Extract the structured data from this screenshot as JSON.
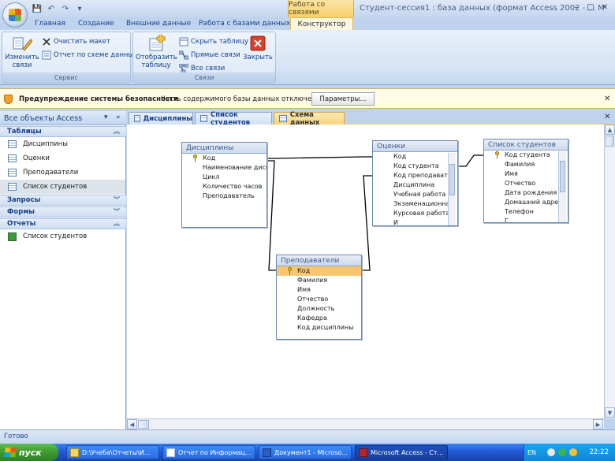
{
  "window": {
    "title": "Студент-сессия1 : база данных (формат Access 2002 - ... М",
    "context_tab_label": "Работа со связями",
    "controls": [
      "–",
      "▢",
      "✕"
    ]
  },
  "qat": {
    "items": [
      "save-icon",
      "undo-icon",
      "redo-icon",
      "customize-icon"
    ]
  },
  "ribbon": {
    "tabs": [
      {
        "label": "Главная",
        "active": false
      },
      {
        "label": "Создание",
        "active": false
      },
      {
        "label": "Внешние данные",
        "active": false
      },
      {
        "label": "Работа с базами данных",
        "active": false
      },
      {
        "label": "Конструктор",
        "active": true
      }
    ],
    "groups": {
      "service": {
        "label": "Сервис",
        "edit_relations": "Изменить связи",
        "clear_layout": "Очистить макет",
        "relationship_report": "Отчет по схеме данных"
      },
      "relations": {
        "label": "Связи",
        "show_table": "Отобразить таблицу",
        "hide_table": "Скрыть таблицу",
        "direct_relations": "Прямые связи",
        "all_relations": "Все связи",
        "close": "Закрыть"
      }
    }
  },
  "message_bar": {
    "title": "Предупреждение системы безопасности",
    "text": "Часть содержимого базы данных отключено",
    "button": "Параметры..."
  },
  "nav": {
    "title": "Все объекты Access",
    "groups": [
      {
        "label": "Таблицы",
        "chevron": "︽",
        "items": [
          "Дисциплины",
          "Оценки",
          "Преподаватели",
          "Список студентов"
        ]
      },
      {
        "label": "Запросы",
        "chevron": "︾",
        "items": []
      },
      {
        "label": "Формы",
        "chevron": "︾",
        "items": []
      },
      {
        "label": "Отчеты",
        "chevron": "︽",
        "items": [
          "Список студентов"
        ]
      }
    ]
  },
  "doc_tabs": [
    {
      "label": "Дисциплины",
      "active": false
    },
    {
      "label": "Список студентов",
      "active": false
    },
    {
      "label": "Схема данных",
      "active": true
    }
  ],
  "tables": {
    "disciplines": {
      "title": "Дисциплины",
      "fields": [
        "Код",
        "Наименование дисц",
        "Цикл",
        "Количество часов",
        "Преподаватель"
      ]
    },
    "grades": {
      "title": "Оценки",
      "fields": [
        "Код",
        "Код студента",
        "Код преподавате",
        "Дисциплина",
        "Учебная работа",
        "Экзаменационна",
        "Курсовая работа",
        "И"
      ]
    },
    "students": {
      "title": "Список студентов",
      "fields": [
        "Код студента",
        "Фамилия",
        "Имя",
        "Отчество",
        "Дата рождения",
        "Домашний адре",
        "Телефон",
        "Г"
      ]
    },
    "teachers": {
      "title": "Преподаватели",
      "fields": [
        "Код",
        "Фамилия",
        "Имя",
        "Отчество",
        "Должность",
        "Кафедра",
        "Код дисциплины"
      ]
    }
  },
  "status": {
    "text": "Готово"
  },
  "taskbar": {
    "start": "пуск",
    "items": [
      {
        "label": "D:\\Учеба\\Отчеты\\И...",
        "active": false
      },
      {
        "label": "Отчет по Информац...",
        "active": false
      },
      {
        "label": "Документ1 - Microso...",
        "active": false
      },
      {
        "label": "Microsoft Access - Ст...",
        "active": true
      }
    ],
    "lang": "EN",
    "clock": "22:22"
  }
}
